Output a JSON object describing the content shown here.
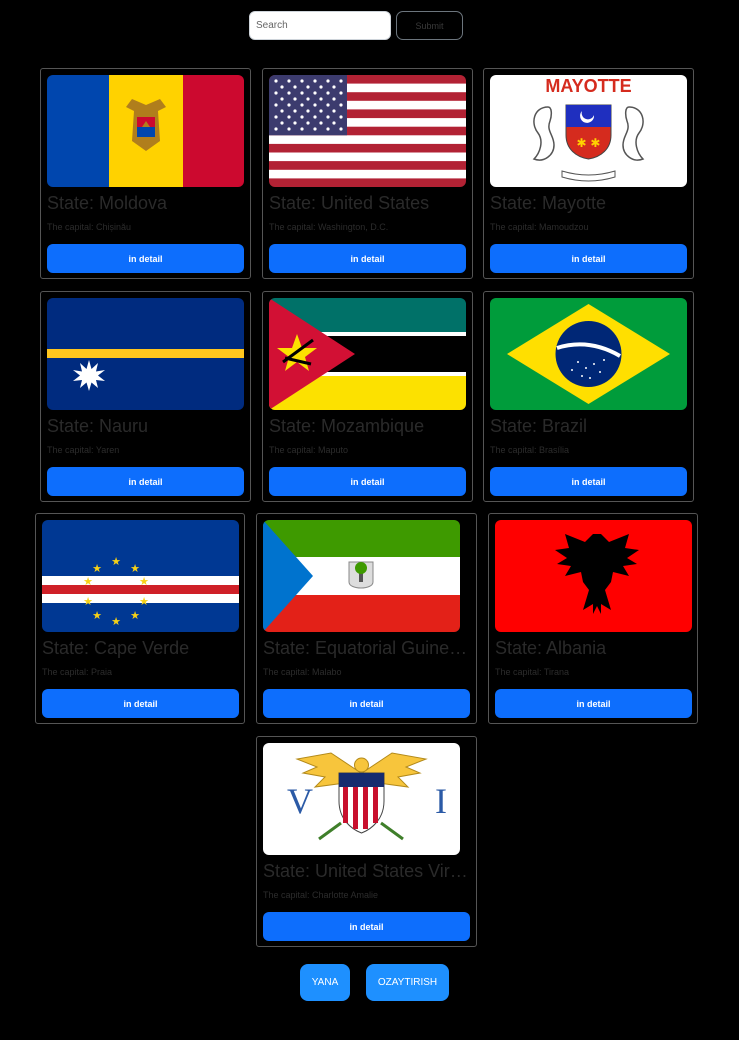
{
  "search": {
    "placeholder": "Search",
    "submit_label": "Submit"
  },
  "cards": [
    {
      "flag": "moldova-flag",
      "title": "State: Moldova",
      "capital": "The capital: Chișinău",
      "button": "in detail"
    },
    {
      "flag": "united-states-flag",
      "title": "State: United States",
      "capital": "The capital: Washington, D.C.",
      "button": "in detail"
    },
    {
      "flag": "mayotte-flag",
      "flag_text": "MAYOTTE",
      "title": "State: Mayotte",
      "capital": "The capital: Mamoudzou",
      "button": "in detail"
    },
    {
      "flag": "nauru-flag",
      "title": "State: Nauru",
      "capital": "The capital: Yaren",
      "button": "in detail"
    },
    {
      "flag": "mozambique-flag",
      "title": "State: Mozambique",
      "capital": "The capital: Maputo",
      "button": "in detail"
    },
    {
      "flag": "brazil-flag",
      "title": "State: Brazil",
      "capital": "The capital: Brasília",
      "button": "in detail"
    },
    {
      "flag": "cape-verde-flag",
      "title": "State: Cape Verde",
      "capital": "The capital: Praia",
      "button": "in detail"
    },
    {
      "flag": "equatorial-guinea-flag",
      "title": "State: Equatorial Guinea...",
      "capital": "The capital: Malabo",
      "button": "in detail"
    },
    {
      "flag": "albania-flag",
      "title": "State: Albania",
      "capital": "The capital: Tirana",
      "button": "in detail"
    },
    {
      "flag": "us-virgin-islands-flag",
      "title": "State: United States Virg...",
      "capital": "The capital: Charlotte Amalie",
      "button": "in detail"
    }
  ],
  "pagination": {
    "next_label": "YANA",
    "reset_label": "OZAYTIRISH"
  },
  "colors": {
    "accent": "#0d6efd",
    "pager": "#1e90ff",
    "background": "#000000"
  }
}
